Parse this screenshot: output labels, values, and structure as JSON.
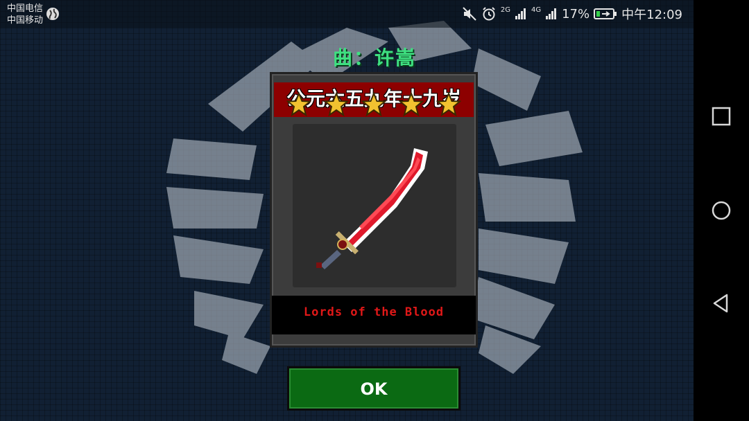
{
  "status_bar": {
    "carrier_1": "中国电信",
    "carrier_2": "中国移动",
    "network_1": "2G",
    "network_2": "4G",
    "battery": "17%",
    "clock": "中午12:09"
  },
  "dialog": {
    "credit": "曲：许嵩",
    "title": "公元六五九年十九岁",
    "star_count": 5,
    "item_name": "Lords of the Blood",
    "ok_label": "OK"
  },
  "colors": {
    "credit_green": "#3ee080",
    "title_band_red": "#8d0000",
    "item_name_red": "#e01818",
    "ok_green": "#0b6a13",
    "star_gold": "#f2c230"
  },
  "navigation": {
    "recent_icon": "square-icon",
    "home_icon": "circle-icon",
    "back_icon": "triangle-back-icon"
  }
}
